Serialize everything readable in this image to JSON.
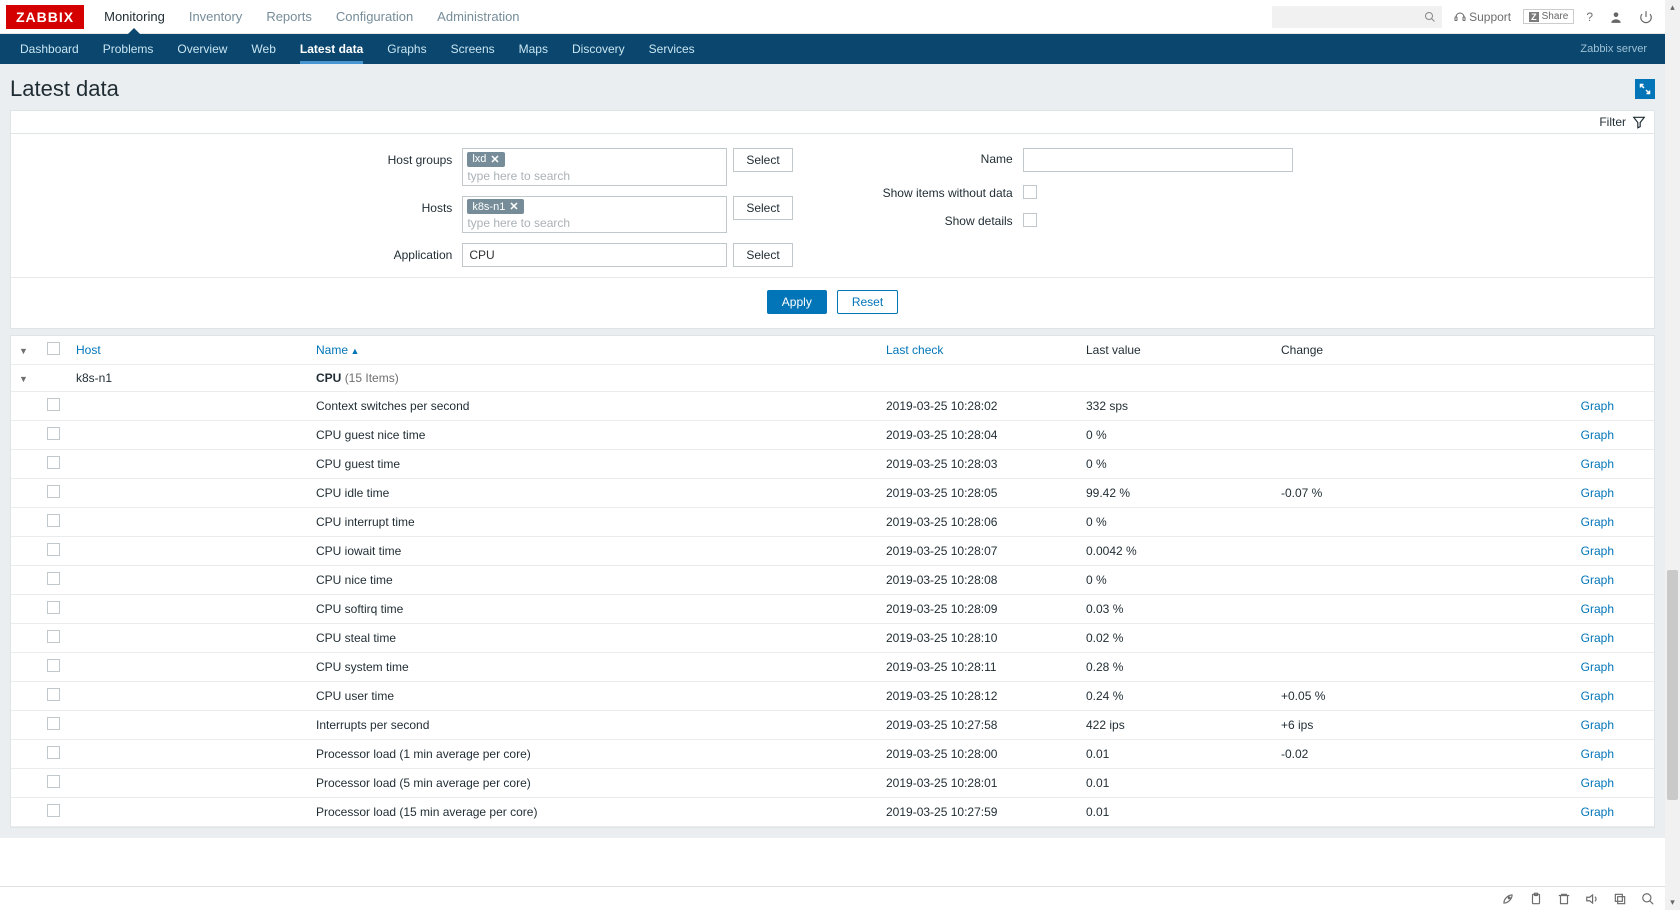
{
  "brand": "ZABBIX",
  "main_nav": [
    "Monitoring",
    "Inventory",
    "Reports",
    "Configuration",
    "Administration"
  ],
  "main_nav_active": 0,
  "top": {
    "support": "Support",
    "share": "Share"
  },
  "sub_nav": [
    "Dashboard",
    "Problems",
    "Overview",
    "Web",
    "Latest data",
    "Graphs",
    "Screens",
    "Maps",
    "Discovery",
    "Services"
  ],
  "sub_nav_active": 4,
  "server_label": "Zabbix server",
  "page_title": "Latest data",
  "filter_label": "Filter",
  "filter": {
    "labels": {
      "host_groups": "Host groups",
      "hosts": "Hosts",
      "application": "Application",
      "name": "Name",
      "show_without": "Show items without data",
      "show_details": "Show details",
      "select": "Select",
      "placeholder": "type here to search"
    },
    "host_groups": [
      "lxd"
    ],
    "hosts": [
      "k8s-n1"
    ],
    "application": "CPU",
    "buttons": {
      "apply": "Apply",
      "reset": "Reset"
    }
  },
  "columns": {
    "host": "Host",
    "name": "Name",
    "last_check": "Last check",
    "last_value": "Last value",
    "change": "Change",
    "action": "Graph"
  },
  "group": {
    "host": "k8s-n1",
    "app": "CPU",
    "count": "(15 Items)"
  },
  "rows": [
    {
      "name": "Context switches per second",
      "check": "2019-03-25 10:28:02",
      "value": "332 sps",
      "change": ""
    },
    {
      "name": "CPU guest nice time",
      "check": "2019-03-25 10:28:04",
      "value": "0 %",
      "change": ""
    },
    {
      "name": "CPU guest time",
      "check": "2019-03-25 10:28:03",
      "value": "0 %",
      "change": ""
    },
    {
      "name": "CPU idle time",
      "check": "2019-03-25 10:28:05",
      "value": "99.42 %",
      "change": "-0.07 %"
    },
    {
      "name": "CPU interrupt time",
      "check": "2019-03-25 10:28:06",
      "value": "0 %",
      "change": ""
    },
    {
      "name": "CPU iowait time",
      "check": "2019-03-25 10:28:07",
      "value": "0.0042 %",
      "change": ""
    },
    {
      "name": "CPU nice time",
      "check": "2019-03-25 10:28:08",
      "value": "0 %",
      "change": ""
    },
    {
      "name": "CPU softirq time",
      "check": "2019-03-25 10:28:09",
      "value": "0.03 %",
      "change": ""
    },
    {
      "name": "CPU steal time",
      "check": "2019-03-25 10:28:10",
      "value": "0.02 %",
      "change": ""
    },
    {
      "name": "CPU system time",
      "check": "2019-03-25 10:28:11",
      "value": "0.28 %",
      "change": ""
    },
    {
      "name": "CPU user time",
      "check": "2019-03-25 10:28:12",
      "value": "0.24 %",
      "change": "+0.05 %"
    },
    {
      "name": "Interrupts per second",
      "check": "2019-03-25 10:27:58",
      "value": "422 ips",
      "change": "+6 ips"
    },
    {
      "name": "Processor load (1 min average per core)",
      "check": "2019-03-25 10:28:00",
      "value": "0.01",
      "change": "-0.02"
    },
    {
      "name": "Processor load (5 min average per core)",
      "check": "2019-03-25 10:28:01",
      "value": "0.01",
      "change": ""
    },
    {
      "name": "Processor load (15 min average per core)",
      "check": "2019-03-25 10:27:59",
      "value": "0.01",
      "change": ""
    }
  ]
}
